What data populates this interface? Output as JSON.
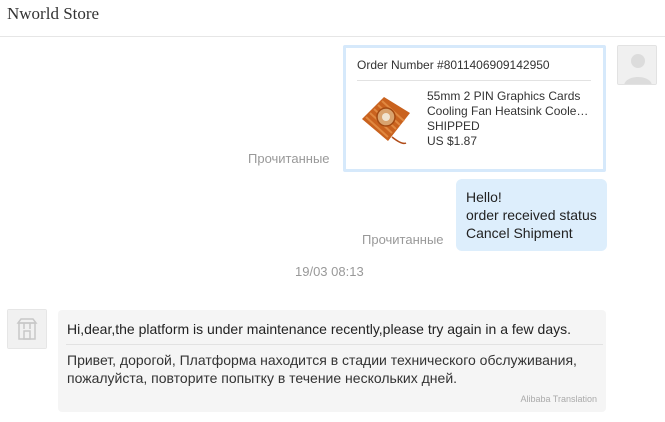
{
  "header": {
    "store_name": "Nworld Store"
  },
  "order_card": {
    "order_number": "Order Number #8011406909142950",
    "product_title_line1": "55mm 2 PIN Graphics Cards",
    "product_title_line2": "Cooling Fan Heatsink Coole…",
    "status": "SHIPPED",
    "price": "US $1.87"
  },
  "read_status_1": "Прочитанные",
  "read_status_2": "Прочитанные",
  "outgoing_message": {
    "line1": "Hello!",
    "line2": "order received status",
    "line3": "Cancel Shipment"
  },
  "timestamp": "19/03 08:13",
  "incoming_message": {
    "original": "Hi,dear,the platform is under maintenance recently,please try again in a few days.",
    "translation_line1": "Привет, дорогой, Платформа находится в стадии технического обслуживания,",
    "translation_line2": "пожалуйста, повторите попытку в течение нескольких дней.",
    "credit": "Alibaba Translation"
  },
  "colors": {
    "outgoing_bubble": "#ddeefc",
    "order_card_border": "#d6e9fb",
    "incoming_bubble": "#f5f5f5",
    "muted_text": "#999999"
  },
  "icons": {
    "user_avatar": "user-silhouette-icon",
    "store_avatar": "store-icon"
  }
}
